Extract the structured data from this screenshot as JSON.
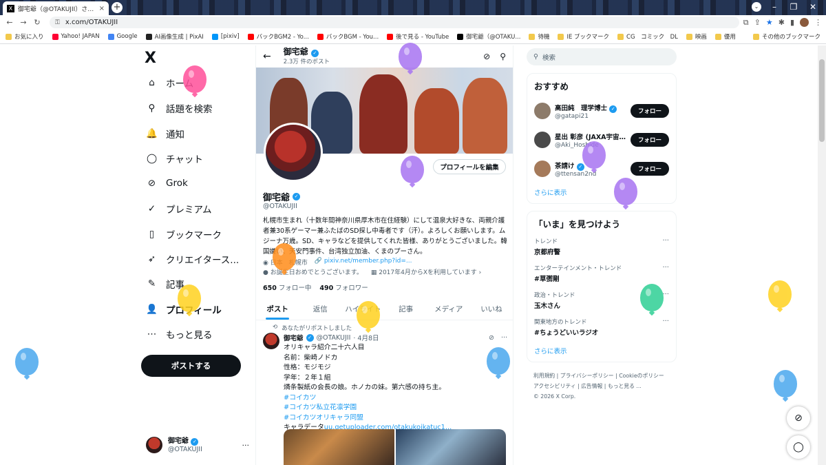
{
  "browser": {
    "tab_title": "御宅爺（@OTAKUJII）さん / X",
    "tab_close": "×",
    "new_tab": "+",
    "url": "x.com/OTAKUJII",
    "bookmarks": [
      {
        "label": "お気に入り",
        "color": "#f2c94c"
      },
      {
        "label": "Yahoo! JAPAN",
        "color": "#ff0033"
      },
      {
        "label": "Google",
        "color": "#4285f4"
      },
      {
        "label": "AI画像生成 | PixAI",
        "color": "#222222"
      },
      {
        "label": "[pixiv]",
        "color": "#0096fa"
      },
      {
        "label": "バックBGM2 - Yo...",
        "color": "#ff0000"
      },
      {
        "label": "バックBGM - You...",
        "color": "#ff0000"
      },
      {
        "label": "後で見る - YouTube",
        "color": "#ff0000"
      },
      {
        "label": "御宅爺（@OTAKU...",
        "color": "#000000"
      },
      {
        "label": "待機",
        "color": "#f2c94c"
      },
      {
        "label": "IE ブックマーク",
        "color": "#f2c94c"
      },
      {
        "label": "CG　コミック　DL",
        "color": "#f2c94c"
      },
      {
        "label": "映画",
        "color": "#f2c94c"
      },
      {
        "label": "優用",
        "color": "#f2c94c"
      }
    ],
    "other_bookmarks": "その他のブックマーク"
  },
  "leftnav": {
    "logo": "X",
    "items": [
      {
        "label": "ホーム",
        "icon": "home-icon",
        "glyph": "⌂"
      },
      {
        "label": "話題を検索",
        "icon": "search-icon",
        "glyph": "⚲"
      },
      {
        "label": "通知",
        "icon": "bell-icon",
        "glyph": "🔔"
      },
      {
        "label": "チャット",
        "icon": "chat-icon",
        "glyph": "◯"
      },
      {
        "label": "Grok",
        "icon": "grok-icon",
        "glyph": "⊘"
      },
      {
        "label": "プレミアム",
        "icon": "premium-icon",
        "glyph": "✓"
      },
      {
        "label": "ブックマーク",
        "icon": "bookmark-icon",
        "glyph": "▯"
      },
      {
        "label": "クリエイタース...",
        "icon": "rocket-icon",
        "glyph": "➶"
      },
      {
        "label": "記事",
        "icon": "article-icon",
        "glyph": "✎"
      },
      {
        "label": "プロフィール",
        "icon": "profile-icon",
        "glyph": "👤"
      },
      {
        "label": "もっと見る",
        "icon": "more-icon",
        "glyph": "⋯"
      }
    ],
    "post_button": "ポストする",
    "account": {
      "name": "御宅爺",
      "handle": "@OTAKUJII",
      "more": "···"
    }
  },
  "header": {
    "back": "←",
    "name": "御宅爺",
    "post_count": "2.3万 件のポスト"
  },
  "profile": {
    "edit_button": "プロフィールを編集",
    "name": "御宅爺",
    "handle": "@OTAKUJII",
    "bio": "札幌市生まれ（十数年間神奈川県厚木市在住経験）にして温泉大好きな、両親介護者兼30系ゲーマー兼ふたばのSD探し中毒者です（汗）。よろしくお願いします。ムジーナ万歳。SD、キャラなどを提供してくれた皆様、ありがとうございました。韓国嫌い、天安門事件、台湾独立加油、くまのプーさん。",
    "location": "日本　札幌市",
    "link": "pixiv.net/member.php?id=...",
    "birthday": "お誕生日おめでとうございます。",
    "joined": "2017年4月からXを利用しています",
    "following_count": "650",
    "following_label": "フォロー中",
    "followers_count": "490",
    "followers_label": "フォロワー"
  },
  "tabs": [
    "ポスト",
    "返信",
    "ハイライト",
    "記事",
    "メディア",
    "いいね"
  ],
  "tweet": {
    "repost_note": "あなたがリポストしました",
    "name": "御宅爺",
    "handle": "@OTAKUJII",
    "date": "· 4月8日",
    "more": "···",
    "lines": [
      "オリキャラ紹介二十六人目",
      "名前：柴崎ノドカ",
      "性格：モジモジ",
      "学年：２年１組",
      "燐条製紙の会長の娘。ホノカの妹。第六感の持ち主。"
    ],
    "tags": [
      "#コイカツ",
      "#コイカツ私立花凛学園",
      "#コイカツオリキャラ同盟"
    ],
    "data_prefix": "キャラデータ",
    "data_link": "uu.getuploader.com/otakukoikatuc1..."
  },
  "sidebar": {
    "search_placeholder": "検索",
    "rec_title": "おすすめ",
    "recommendations": [
      {
        "name": "高田純　理学博士",
        "handle": "@gatapi21",
        "button": "フォロー",
        "color": "#8d7b6a"
      },
      {
        "name": "星出 彰彦 (JAXA宇宙...",
        "handle": "@Aki_Hoshide",
        "button": "フォロー",
        "color": "#4a4a4a"
      },
      {
        "name": "茶請け",
        "handle": "@ttensan2nd",
        "button": "フォロー",
        "color": "#a57a5a"
      }
    ],
    "rec_more": "さらに表示",
    "trend_title": "「いま」を見つけよう",
    "trends": [
      {
        "category": "トレンド",
        "topic": "京都府警"
      },
      {
        "category": "エンターテインメント・トレンド",
        "topic": "#草彅剛"
      },
      {
        "category": "政治・トレンド",
        "topic": "玉木さん"
      },
      {
        "category": "関東地方のトレンド",
        "topic": "#ちょうどいいラジオ"
      }
    ],
    "trend_more": "さらに表示",
    "footer_links": [
      "利用規約",
      "プライバシーポリシー",
      "Cookieのポリシー",
      "アクセシビリティ",
      "広告情報",
      "もっと見る ..."
    ],
    "copyright": "© 2026 X Corp."
  },
  "colors": {
    "accent": "#1d9bf0",
    "text": "#0f1419",
    "muted": "#536471",
    "balloon_pink": "#ff4f9a",
    "balloon_purple": "#a774f2",
    "balloon_blue": "#4aa8ee",
    "balloon_yellow": "#ffd21f",
    "balloon_orange": "#ff8c1a",
    "balloon_green": "#2fcf95"
  }
}
